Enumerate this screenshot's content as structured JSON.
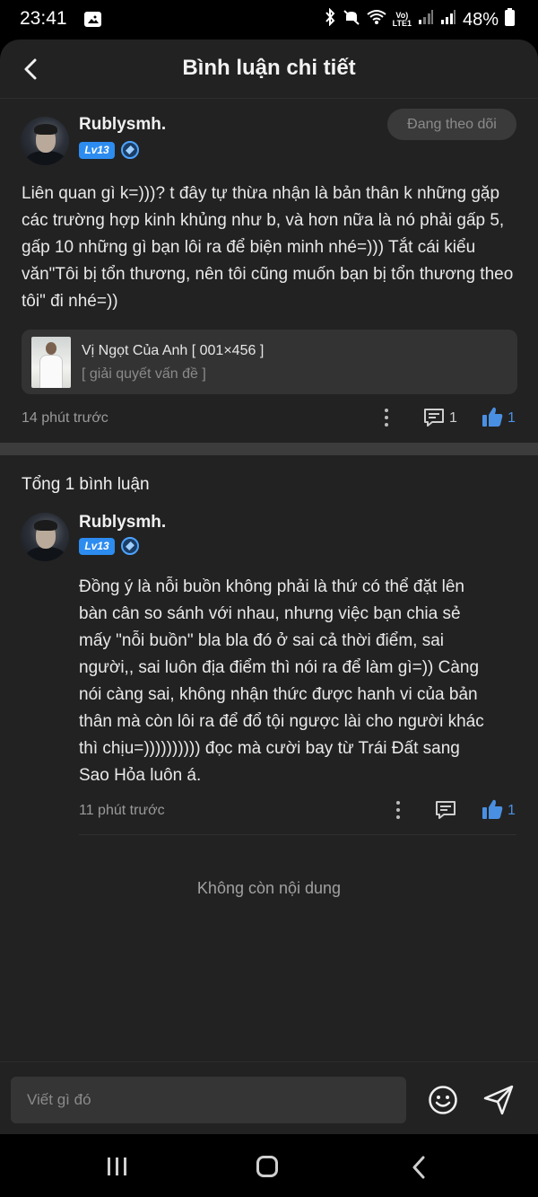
{
  "status_bar": {
    "time": "23:41",
    "net_label_top": "Vo)",
    "net_label_bottom": "LTE1",
    "battery": "48%",
    "icons": [
      "gallery-icon",
      "bluetooth-icon",
      "mute-icon",
      "wifi-icon",
      "signal-icon",
      "battery-icon"
    ]
  },
  "header": {
    "title": "Bình luận chi tiết",
    "back_icon": "chevron-left-icon"
  },
  "post": {
    "username": "Rublysmh.",
    "level": "Lv13",
    "follow_label": "Đang theo dõi",
    "text": "Liên quan gì k=)))? t đây tự thừa nhận là bản thân k những gặp các trường hợp kinh khủng như b, và hơn nữa là nó phải gấp 5, gấp 10 những gì bạn lôi ra để biện minh nhé=))) Tắt cái kiểu văn\"Tôi bị tổn thương, nên tôi cũng muốn bạn bị tổn thương theo tôi\" đi nhé=))",
    "linked": {
      "title": "Vị Ngọt Của Anh [ 001×456 ]",
      "subtitle": "[ giải quyết vấn đề ]"
    },
    "time": "14 phút trước",
    "comment_count": "1",
    "like_count": "1"
  },
  "comments": {
    "total_label": "Tổng 1 bình luận",
    "items": [
      {
        "username": "Rublysmh.",
        "level": "Lv13",
        "text": "Đồng ý là nỗi buồn không phải là thứ có thể đặt lên bàn cân so sánh với nhau, nhưng việc bạn chia sẻ mấy \"nỗi buồn\" bla bla đó ở sai cả thời điểm, sai người,, sai luôn địa điểm thì nói ra để làm gì=)) Càng nói càng sai, không nhận thức được hanh vi của bản thân mà còn lôi ra để đổ tội ngược lài cho người khác thì chịu=)))))))))) đọc mà cười bay từ Trái Đất sang Sao Hỏa luôn á.",
        "time": "11 phút trước",
        "like_count": "1"
      }
    ],
    "end_label": "Không còn nội dung"
  },
  "input": {
    "placeholder": "Viết gì đó"
  },
  "colors": {
    "background": "#222222",
    "accent_blue": "#4a90e2",
    "level_badge": "#2d8cf0",
    "muted_text": "#9a9a9a"
  }
}
